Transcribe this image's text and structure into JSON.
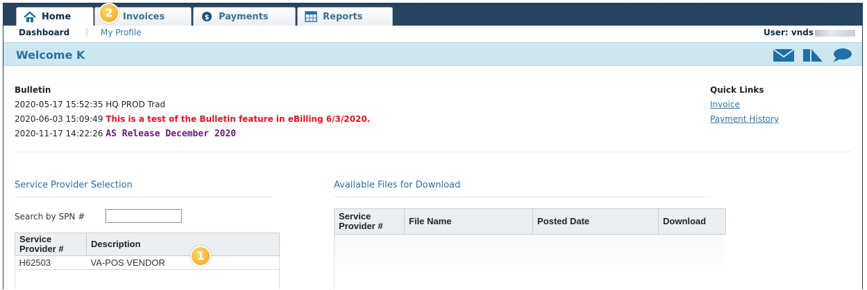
{
  "tabs": [
    {
      "label": "Home",
      "icon": "home-icon"
    },
    {
      "label": "Invoices",
      "icon": "invoice-icon"
    },
    {
      "label": "Payments",
      "icon": "dollar-icon"
    },
    {
      "label": "Reports",
      "icon": "grid-icon"
    }
  ],
  "subnav": {
    "dashboard": "Dashboard",
    "separator": "|",
    "my_profile": "My Profile",
    "user_label": "User: vnds"
  },
  "welcome": {
    "title": "Welcome K",
    "icons": [
      "mail-icon",
      "page-icon",
      "chat-icon"
    ]
  },
  "bulletin": {
    "heading": "Bulletin",
    "entries": [
      {
        "timestamp": "2020-05-17 15:52:35",
        "text": "HQ PROD Trad"
      },
      {
        "timestamp": "2020-06-03 15:09:49",
        "text": "This is a test of the Bulletin feature in eBilling 6/3/2020."
      },
      {
        "timestamp": "2020-11-17 14:22:26",
        "text": "AS Release December 2020"
      }
    ]
  },
  "quick_links": {
    "heading": "Quick Links",
    "links": [
      "Invoice",
      "Payment History"
    ]
  },
  "service_provider": {
    "title": "Service Provider Selection",
    "search_label": "Search by SPN #",
    "search_value": "",
    "columns": [
      "Service Provider #",
      "Description"
    ],
    "rows": [
      {
        "spn": "H62503",
        "description": "VA-POS VENDOR"
      }
    ]
  },
  "files": {
    "title": "Available Files for Download",
    "columns": [
      "Service Provider #",
      "File Name",
      "Posted Date",
      "Download"
    ]
  },
  "callouts": [
    "1",
    "2"
  ],
  "colors": {
    "navy": "#23425e",
    "welcome_bg": "#cde7f2",
    "link": "#2f76b0",
    "red_text": "#e1151f",
    "purple_text": "#6a1a7a",
    "callout": "#f0a41a"
  }
}
